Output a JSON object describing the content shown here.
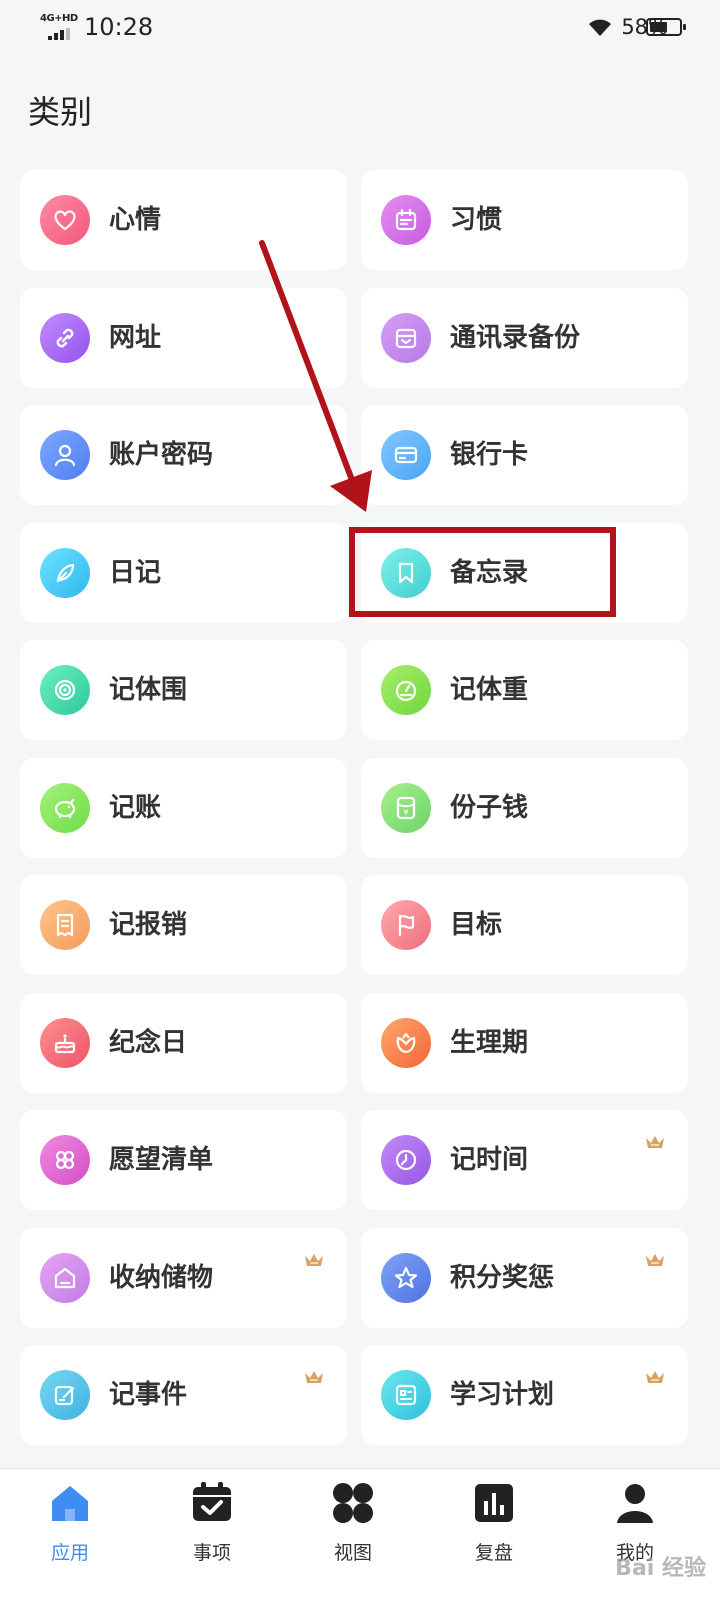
{
  "status_bar": {
    "network": "4G+HD",
    "time": "10:28",
    "battery": "58%"
  },
  "page_title": "类别",
  "categories": [
    {
      "label": "心情",
      "icon": "heart-icon",
      "color_from": "#ff8aa3",
      "color_to": "#f2597a",
      "premium": false
    },
    {
      "label": "习惯",
      "icon": "calendar-icon",
      "color_from": "#e58ef2",
      "color_to": "#c65be0",
      "premium": false
    },
    {
      "label": "网址",
      "icon": "link-icon",
      "color_from": "#c18cff",
      "color_to": "#9552ee",
      "premium": false
    },
    {
      "label": "通讯录备份",
      "icon": "contact-book-icon",
      "color_from": "#d79ef4",
      "color_to": "#b47ae6",
      "premium": false
    },
    {
      "label": "账户密码",
      "icon": "user-icon",
      "color_from": "#7ea8ff",
      "color_to": "#4f7ef0",
      "premium": false
    },
    {
      "label": "银行卡",
      "icon": "card-icon",
      "color_from": "#7fc8ff",
      "color_to": "#4da4f4",
      "premium": false
    },
    {
      "label": "日记",
      "icon": "feather-icon",
      "color_from": "#6fe1ff",
      "color_to": "#2fb8f0",
      "premium": false
    },
    {
      "label": "备忘录",
      "icon": "bookmark-icon",
      "color_from": "#7ef0ea",
      "color_to": "#3fcfd0",
      "premium": false
    },
    {
      "label": "记体围",
      "icon": "measure-tape-icon",
      "color_from": "#6cefc1",
      "color_to": "#2dc99a",
      "premium": false
    },
    {
      "label": "记体重",
      "icon": "scale-icon",
      "color_from": "#a8ef6c",
      "color_to": "#6fd63c",
      "premium": false
    },
    {
      "label": "记账",
      "icon": "piggy-bank-icon",
      "color_from": "#a6f27a",
      "color_to": "#6fdc4b",
      "premium": false
    },
    {
      "label": "份子钱",
      "icon": "money-envelope-icon",
      "color_from": "#a8f08c",
      "color_to": "#6cd467",
      "premium": false
    },
    {
      "label": "记报销",
      "icon": "receipt-icon",
      "color_from": "#ffc48a",
      "color_to": "#f49b5c",
      "premium": false
    },
    {
      "label": "目标",
      "icon": "flag-icon",
      "color_from": "#ffa8ae",
      "color_to": "#ee6f7c",
      "premium": false
    },
    {
      "label": "纪念日",
      "icon": "cake-icon",
      "color_from": "#ff8f8f",
      "color_to": "#ee5468",
      "premium": false
    },
    {
      "label": "生理期",
      "icon": "flower-icon",
      "color_from": "#ffa56b",
      "color_to": "#f2683a",
      "premium": false
    },
    {
      "label": "愿望清单",
      "icon": "clover-icon",
      "color_from": "#f08ae0",
      "color_to": "#d24fc4",
      "premium": false
    },
    {
      "label": "记时间",
      "icon": "clock-icon",
      "color_from": "#c48af6",
      "color_to": "#9556e6",
      "premium": true
    },
    {
      "label": "收纳储物",
      "icon": "storage-box-icon",
      "color_from": "#e4a6f4",
      "color_to": "#c37ae6",
      "premium": true
    },
    {
      "label": "积分奖惩",
      "icon": "star-icon",
      "color_from": "#7fa2f6",
      "color_to": "#4f72e2",
      "premium": true
    },
    {
      "label": "记事件",
      "icon": "edit-note-icon",
      "color_from": "#76d8f2",
      "color_to": "#3fb2e0",
      "premium": true
    },
    {
      "label": "学习计划",
      "icon": "study-plan-icon",
      "color_from": "#6ae6f0",
      "color_to": "#2fc2dc",
      "premium": true
    }
  ],
  "bottom_nav": [
    {
      "label": "应用",
      "icon": "home-icon",
      "active": true
    },
    {
      "label": "事项",
      "icon": "calendar-check-icon",
      "active": false
    },
    {
      "label": "视图",
      "icon": "grid-view-icon",
      "active": false
    },
    {
      "label": "复盘",
      "icon": "bar-chart-icon",
      "active": false
    },
    {
      "label": "我的",
      "icon": "profile-icon",
      "active": false
    }
  ],
  "colors": {
    "active_nav": "#3f8cf2",
    "highlight": "#b0131a",
    "crown": "#d9a25e"
  },
  "watermark": "Bai 经验"
}
